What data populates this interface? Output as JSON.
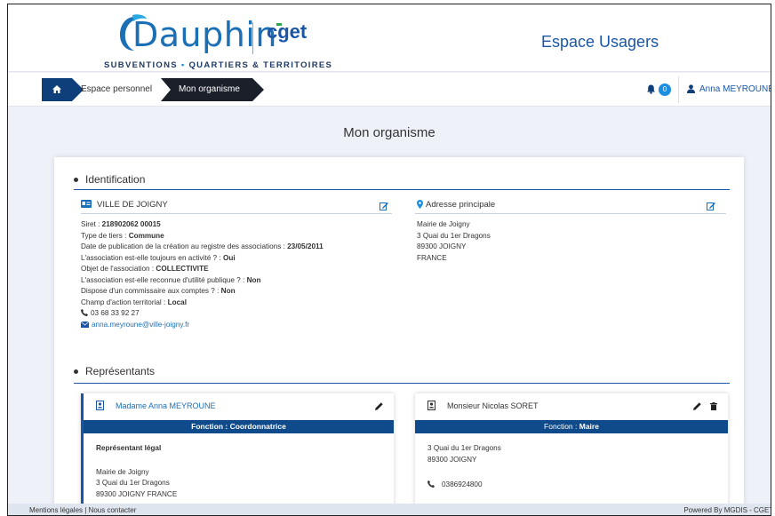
{
  "header": {
    "logo_text": "Dauphin",
    "logo_partner": "cget",
    "tagline_part1": "SUBVENTIONS",
    "tagline_dot": "•",
    "tagline_part2": "QUARTIERS & TERRITOIRES",
    "space_title": "Espace Usagers"
  },
  "breadcrumb": {
    "home_icon": "home-icon",
    "items": [
      "Espace personnel",
      "Mon organisme"
    ]
  },
  "user": {
    "notifications_count": "0",
    "name": "Anna MEYROUNE"
  },
  "page": {
    "title": "Mon organisme"
  },
  "identification": {
    "heading": "Identification",
    "org_name": "VILLE DE JOIGNY",
    "fields": [
      {
        "label": "Siret : ",
        "value": "218902062 00015"
      },
      {
        "label": "Type de tiers : ",
        "value": "Commune"
      },
      {
        "label": "Date de publication de la création au registre des associations : ",
        "value": "23/05/2011"
      },
      {
        "label": "L'association est-elle toujours en activité ? : ",
        "value": "Oui"
      },
      {
        "label": "Objet de l'association : ",
        "value": "COLLECTIVITE"
      },
      {
        "label": "L'association est-elle reconnue d'utilité publique ? : ",
        "value": "Non"
      },
      {
        "label": "Dispose d'un commissaire aux comptes ? : ",
        "value": "Non"
      },
      {
        "label": "Champ d'action territorial : ",
        "value": "Local"
      }
    ],
    "phone": "03 68 33 92 27",
    "email": "anna.meyroune@ville-joigny.fr",
    "address_heading": "Adresse principale",
    "address_lines": [
      "Mairie de Joigny",
      "3 Quai du 1er Dragons",
      "89300 JOIGNY",
      "FRANCE"
    ]
  },
  "representants": {
    "heading": "Représentants",
    "items": [
      {
        "name": "Madame Anna MEYROUNE",
        "function_label": "Fonction : ",
        "function_value": "Coordonnatrice",
        "role": "Représentant légal",
        "address_lines": [
          "Mairie de Joigny",
          "3 Quai du 1er Dragons",
          "89300 JOIGNY FRANCE"
        ]
      },
      {
        "name": "Monsieur Nicolas SORET",
        "function_label": "Fonction : ",
        "function_value": "Maire",
        "address_lines": [
          "3 Quai du 1er Dragons",
          "89300 JOIGNY"
        ],
        "phone": "0386924800"
      }
    ]
  },
  "footer": {
    "left": "Mentions légales | Nous contacter",
    "right": "Powered By MGDIS - CGET -"
  },
  "colors": {
    "brand_blue": "#1b56a6",
    "dark_navy": "#0f3f7a",
    "breadcrumb_active": "#1a1f2a",
    "badge_blue": "#1b8ee0"
  }
}
